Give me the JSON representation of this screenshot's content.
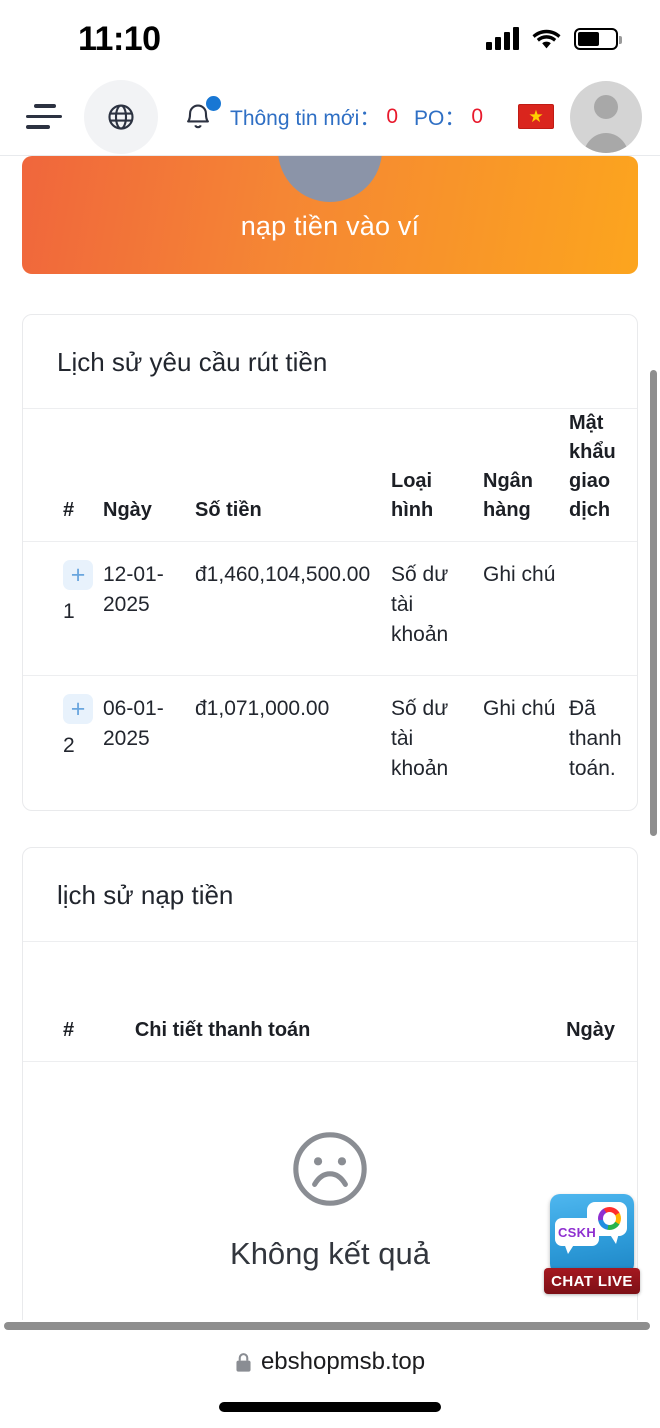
{
  "status_bar": {
    "time": "11:10",
    "signal_icon": "signal-bars-icon",
    "wifi_icon": "wifi-icon",
    "battery_icon": "battery-icon",
    "battery_level_percent": 58
  },
  "header": {
    "menu_icon": "hamburger-menu-icon",
    "globe_icon": "globe-icon",
    "bell_icon": "bell-icon",
    "notification_dot": true,
    "info_label": "Thông tin mới：",
    "info_count": "0",
    "po_label": "PO：",
    "po_count": "0",
    "flag_icon": "vietnam-flag-icon",
    "flag_star": "★",
    "avatar_icon": "user-avatar-icon",
    "link_color": "#2f6fc4",
    "count_color": "#e8192c"
  },
  "banner": {
    "label": "nạp tiền vào ví",
    "gradient_from": "#f0663c",
    "gradient_to": "#fca51e"
  },
  "withdraw_card": {
    "title": "Lịch sử yêu cầu rút tiền",
    "columns": [
      "#",
      "Ngày",
      "Số tiền",
      "Loại hình",
      "Ngân hàng",
      "Mật khẩu giao dịch"
    ],
    "rows": [
      {
        "expand_icon": "plus-icon",
        "index": "1",
        "date": "12-01-2025",
        "amount": "đ1,460,104,500.00",
        "type": "Số dư tài khoản",
        "bank": "Ghi chú",
        "password": ""
      },
      {
        "expand_icon": "plus-icon",
        "index": "2",
        "date": "06-01-2025",
        "amount": "đ1,071,000.00",
        "type": "Số dư tài khoản",
        "bank": "Ghi chú",
        "password": "Đã thanh toán."
      }
    ]
  },
  "deposit_card": {
    "title": "lịch sử nạp tiền",
    "columns": [
      "#",
      "Chi tiết thanh toán",
      "Ngày"
    ],
    "empty_icon": "sad-face-icon",
    "empty_text": "Không kết quả"
  },
  "chat_widget": {
    "bubble_label": "CSKH",
    "ribbon_label": "CHAT LIVE",
    "logo_icon": "color-ring-icon",
    "background_color": "#2f9ddb",
    "ribbon_color": "#a51820"
  },
  "browser_bar": {
    "lock_icon": "lock-icon",
    "url": "ebshopmsb.top"
  }
}
